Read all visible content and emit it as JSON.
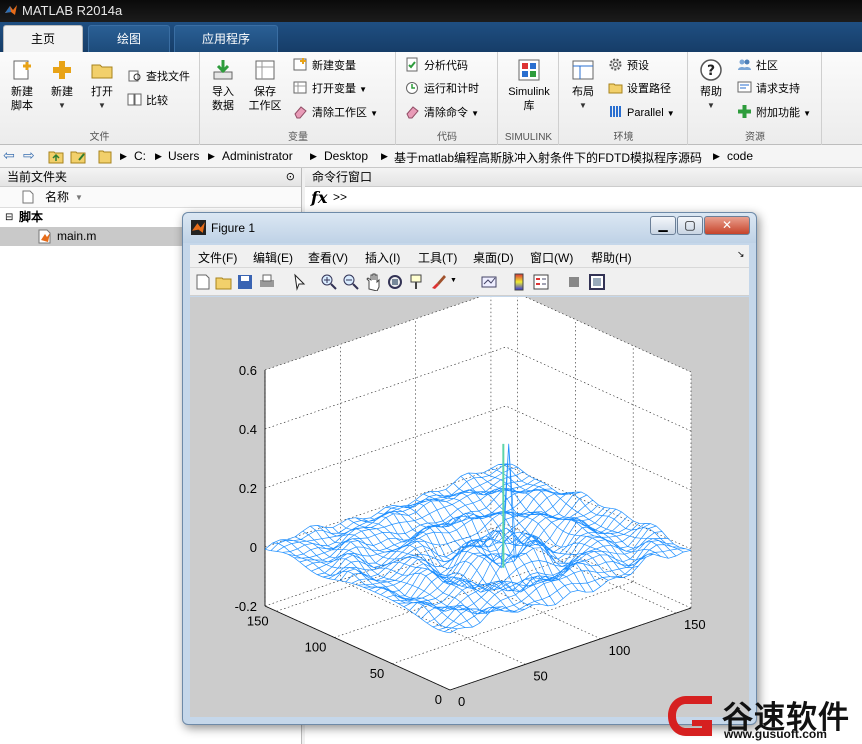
{
  "window": {
    "title": "MATLAB R2014a"
  },
  "tabs": [
    {
      "label": "主页",
      "active": true
    },
    {
      "label": "绘图",
      "active": false
    },
    {
      "label": "应用程序",
      "active": false
    }
  ],
  "ribbon": {
    "file": {
      "label": "文件",
      "new_script": [
        "新建",
        "脚本"
      ],
      "new": "新建",
      "open": "打开",
      "find_files": "查找文件",
      "compare": "比较"
    },
    "variable": {
      "label": "变量",
      "import": [
        "导入",
        "数据"
      ],
      "save_ws": [
        "保存",
        "工作区"
      ],
      "new_var": "新建变量",
      "open_var": "打开变量",
      "clear_ws": "清除工作区"
    },
    "code": {
      "label": "代码",
      "analyze": "分析代码",
      "run_time": "运行和计时",
      "clear_cmd": "清除命令"
    },
    "simulink": {
      "label": "SIMULINK",
      "btn": [
        "Simulink",
        "库"
      ]
    },
    "env": {
      "label": "环境",
      "layout": "布局",
      "prefs": "预设",
      "set_path": "设置路径",
      "parallel": "Parallel"
    },
    "resources": {
      "label": "资源",
      "help": "帮助",
      "community": "社区",
      "support": "请求支持",
      "addons": "附加功能"
    }
  },
  "address": {
    "segments": [
      "C:",
      "Users",
      "Administrator",
      "Desktop",
      "基于matlab编程高斯脉冲入射条件下的FDTD模拟程序源码",
      "code"
    ]
  },
  "left_panel": {
    "title": "当前文件夹",
    "column": "名称",
    "group": "脚本",
    "file": "main.m"
  },
  "cmd_panel": {
    "title": "命令行窗口",
    "fx": "fx",
    "prompt": ">>"
  },
  "figure": {
    "title": "Figure 1",
    "menu": [
      "文件(F)",
      "编辑(E)",
      "查看(V)",
      "插入(I)",
      "工具(T)",
      "桌面(D)",
      "窗口(W)",
      "帮助(H)"
    ],
    "toolbar_icons": [
      "new-figure-icon",
      "open-file-icon",
      "save-icon",
      "print-icon",
      "pointer-icon",
      "zoom-in-icon",
      "zoom-out-icon",
      "pan-icon",
      "rotate-icon",
      "data-cursor-icon",
      "brush-icon",
      "link-icon",
      "colorbar-icon",
      "legend-icon",
      "hide-plot-tools-icon",
      "show-plot-tools-icon"
    ],
    "axes": {
      "z_ticks": [
        "0.6",
        "0.4",
        "0.2",
        "0",
        "-0.2"
      ],
      "y_ticks": [
        "150",
        "100",
        "50",
        "0"
      ],
      "x_ticks": [
        "0",
        "50",
        "100",
        "150"
      ]
    },
    "mesh_color": "#1e8fff"
  },
  "watermark": {
    "text": "谷速软件",
    "url": "www.gusuoft.com"
  }
}
